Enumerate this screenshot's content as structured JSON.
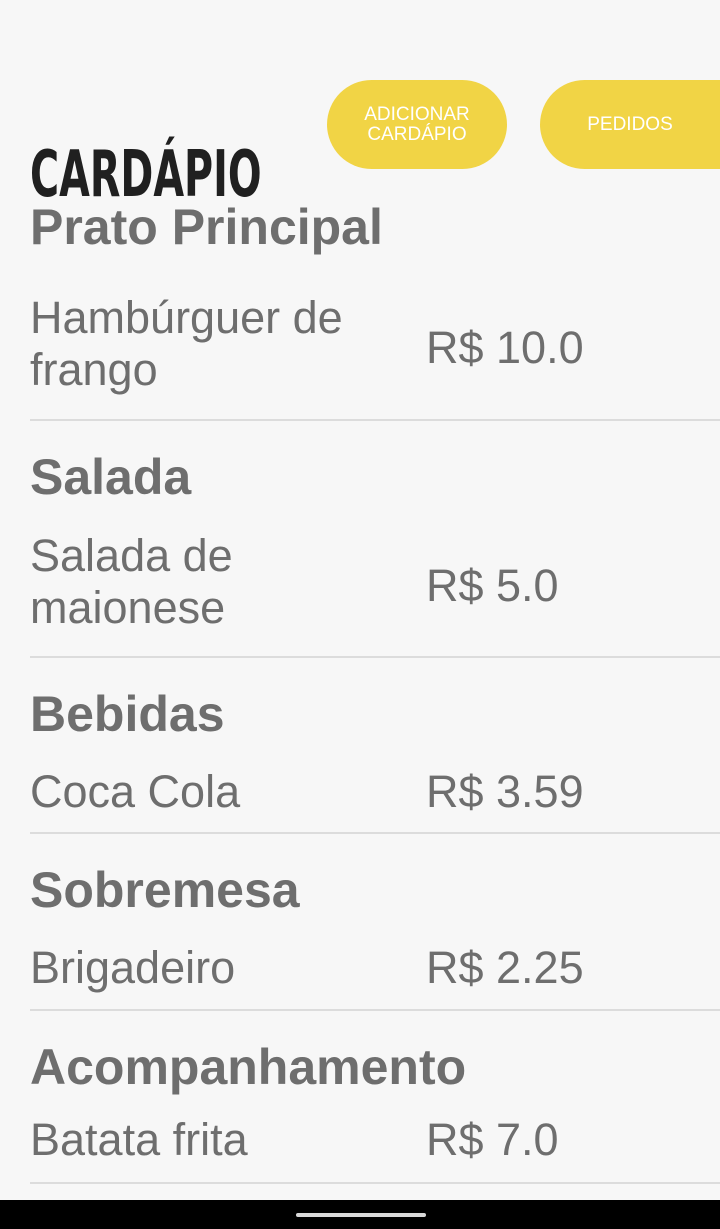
{
  "header": {
    "title": "CARDÁPIO",
    "add_menu_label": "ADICIONAR\nCARDÁPIO",
    "orders_label": "PEDIDOS"
  },
  "menu": {
    "sections": [
      {
        "category": "Prato Principal",
        "item": "Hambúrguer de frango",
        "price": "R$ 10.0"
      },
      {
        "category": "Salada",
        "item": "Salada de maionese",
        "price": "R$ 5.0"
      },
      {
        "category": "Bebidas",
        "item": "Coca Cola",
        "price": "R$ 3.59"
      },
      {
        "category": "Sobremesa",
        "item": "Brigadeiro",
        "price": "R$ 2.25"
      },
      {
        "category": "Acompanhamento",
        "item": "Batata frita",
        "price": "R$ 7.0"
      }
    ]
  },
  "colors": {
    "background": "#f7f7f7",
    "accent": "#f1d445",
    "title": "#202020",
    "text": "#6e6e6e",
    "divider": "#dcdcdc"
  }
}
